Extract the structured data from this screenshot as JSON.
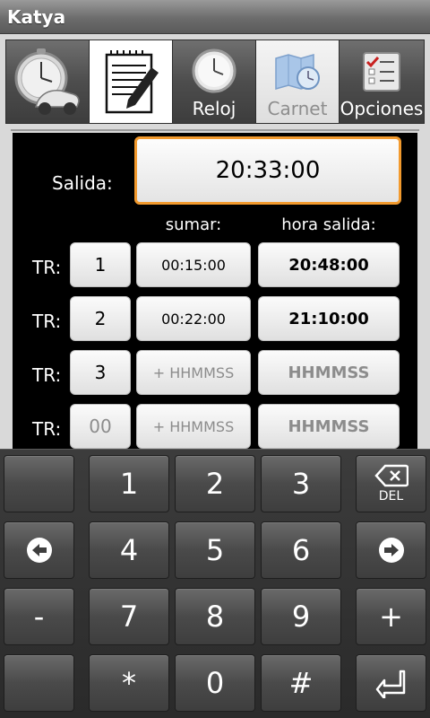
{
  "app": {
    "title": "Katya"
  },
  "tabs": [
    {
      "label": "",
      "icon": "stopwatch-car-icon"
    },
    {
      "label": "",
      "icon": "notepad-pen-icon"
    },
    {
      "label": "Reloj",
      "icon": "clock-icon"
    },
    {
      "label": "Carnet",
      "icon": "map-clock-icon",
      "selected": true
    },
    {
      "label": "Opciones",
      "icon": "checklist-icon"
    }
  ],
  "form": {
    "salida_label": "Salida:",
    "salida_value": "20:33:00",
    "col_sumar": "sumar:",
    "col_hora_salida": "hora salida:",
    "rows": [
      {
        "label": "TR:",
        "num": "1",
        "add": "00:15:00",
        "out": "20:48:00",
        "placeholder": false
      },
      {
        "label": "TR:",
        "num": "2",
        "add": "00:22:00",
        "out": "21:10:00",
        "placeholder": false
      },
      {
        "label": "TR:",
        "num": "3",
        "add": "+ HHMMSS",
        "out": "HHMMSS",
        "placeholder": true
      },
      {
        "label": "TR:",
        "num": "00",
        "add": "+ HHMMSS",
        "out": "HHMMSS",
        "placeholder": true
      }
    ]
  },
  "keyboard": {
    "rows": [
      [
        "",
        "1",
        "2",
        "3",
        "DEL"
      ],
      [
        "⬅",
        "4",
        "5",
        "6",
        "➡"
      ],
      [
        "-",
        "7",
        "8",
        "9",
        "+"
      ],
      [
        "",
        "*",
        "0",
        "#",
        "⏎"
      ]
    ],
    "del_label": "DEL"
  },
  "colors": {
    "accent": "#f29a2e",
    "placeholder": "#8c8c8c"
  }
}
